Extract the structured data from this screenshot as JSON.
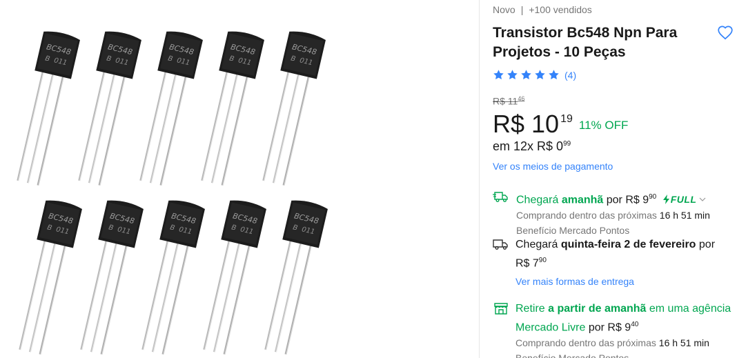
{
  "product": {
    "condition": "Novo",
    "separator": "|",
    "sold": "+100 vendidos",
    "title": "Transistor Bc548 Npn Para Projetos - 10 Peças",
    "rating_stars": 5,
    "rating_count": "(4)",
    "old_price_main": "R$ 11",
    "old_price_cents": "46",
    "price_main": "R$ 10",
    "price_cents": "19",
    "discount": "11% OFF",
    "installments_prefix": "em 12x R$ 0",
    "installments_cents": "99",
    "payment_link": "Ver os meios de pagamento"
  },
  "gallery": {
    "transistor_marking_1": "BC548",
    "transistor_marking_2": "B  011",
    "count": 10
  },
  "shipping": {
    "fast": {
      "arrives": "Chegará",
      "when": "amanhã",
      "by": "por R$ 9",
      "cents": "90",
      "badge": "FULL",
      "note_prefix": "Comprando dentro das próximas",
      "note_time": "16 h 51 min",
      "benefit": "Benefício Mercado Pontos"
    },
    "standard": {
      "arrives": "Chegará",
      "when": "quinta-feira 2 de fevereiro",
      "by": "por",
      "price": "R$ 7",
      "cents": "90",
      "link": "Ver mais formas de entrega"
    },
    "pickup": {
      "retire": "Retire",
      "when": "a partir de amanhã",
      "where": "em uma agência Mercado Livre",
      "by": "por R$ 9",
      "cents": "40",
      "note_prefix": "Comprando dentro das próximas",
      "note_time": "16 h 51 min",
      "benefit": "Benefício Mercado Pontos"
    }
  },
  "colors": {
    "accent_blue": "#3483fa",
    "green": "#00a650"
  }
}
